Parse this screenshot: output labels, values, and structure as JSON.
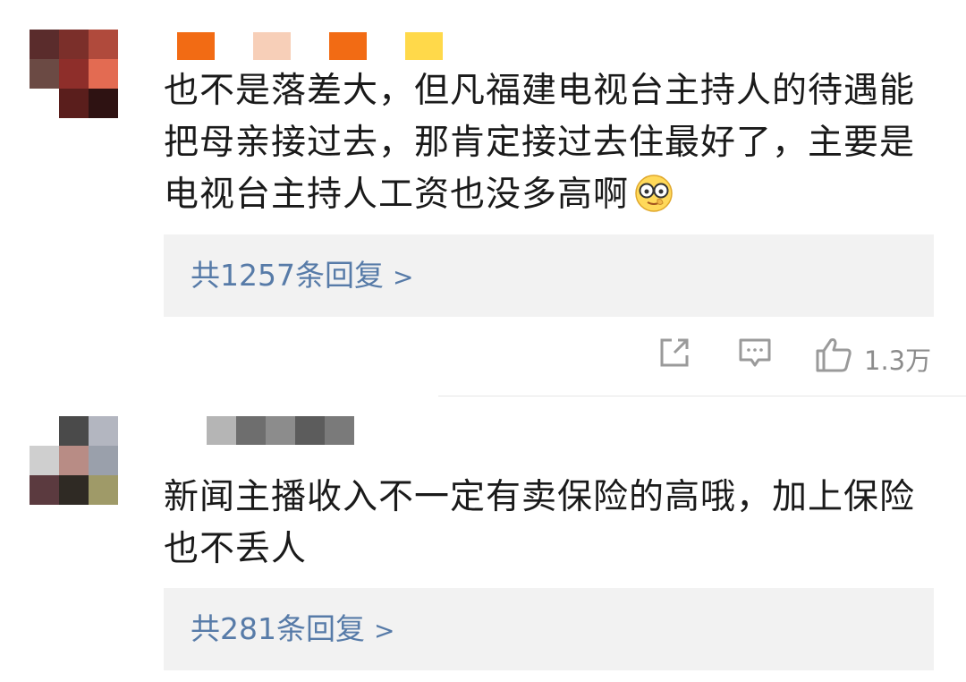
{
  "comments": [
    {
      "text": "也不是落差大，但凡福建电视台主持人的待遇能把母亲接过去，那肯定接过去住最好了，主要是电视台主持人工资也没多高啊",
      "emoji": "nerd-glasses-emoji",
      "reply_label": "共1257条回复",
      "reply_chevron": ">",
      "like_count": "1.3万",
      "avatar_colors": [
        "#5a2c2c",
        "#7b2f2a",
        "#b04a3c",
        "#6b4a44",
        "#8e2e2a",
        "#e36b52",
        "#ffffff",
        "#5a1e1c",
        "#2e1212"
      ],
      "name_colors": [
        "#f26b14",
        "#ffffff",
        "#f7cfb8",
        "#ffffff",
        "#f26b14",
        "#ffffff",
        "#ffd94a"
      ]
    },
    {
      "text": "新闻主播收入不一定有卖保险的高哦，加上保险也不丢人",
      "reply_label": "共281条回复",
      "reply_chevron": ">",
      "avatar_colors": [
        "#ffffff",
        "#4a4a4a",
        "#b3b6c0",
        "#cfcfcf",
        "#b88c85",
        "#9aa0ab",
        "#5b3a3f",
        "#2f2a24",
        "#9f9a68"
      ],
      "name_colors": [
        "#b5b5b5",
        "#6e6e6e",
        "#8c8c8c",
        "#5c5c5c",
        "#7a7a7a"
      ]
    }
  ],
  "icons": {
    "share": "share-icon",
    "comment": "comment-icon",
    "like": "thumbs-up-icon"
  }
}
